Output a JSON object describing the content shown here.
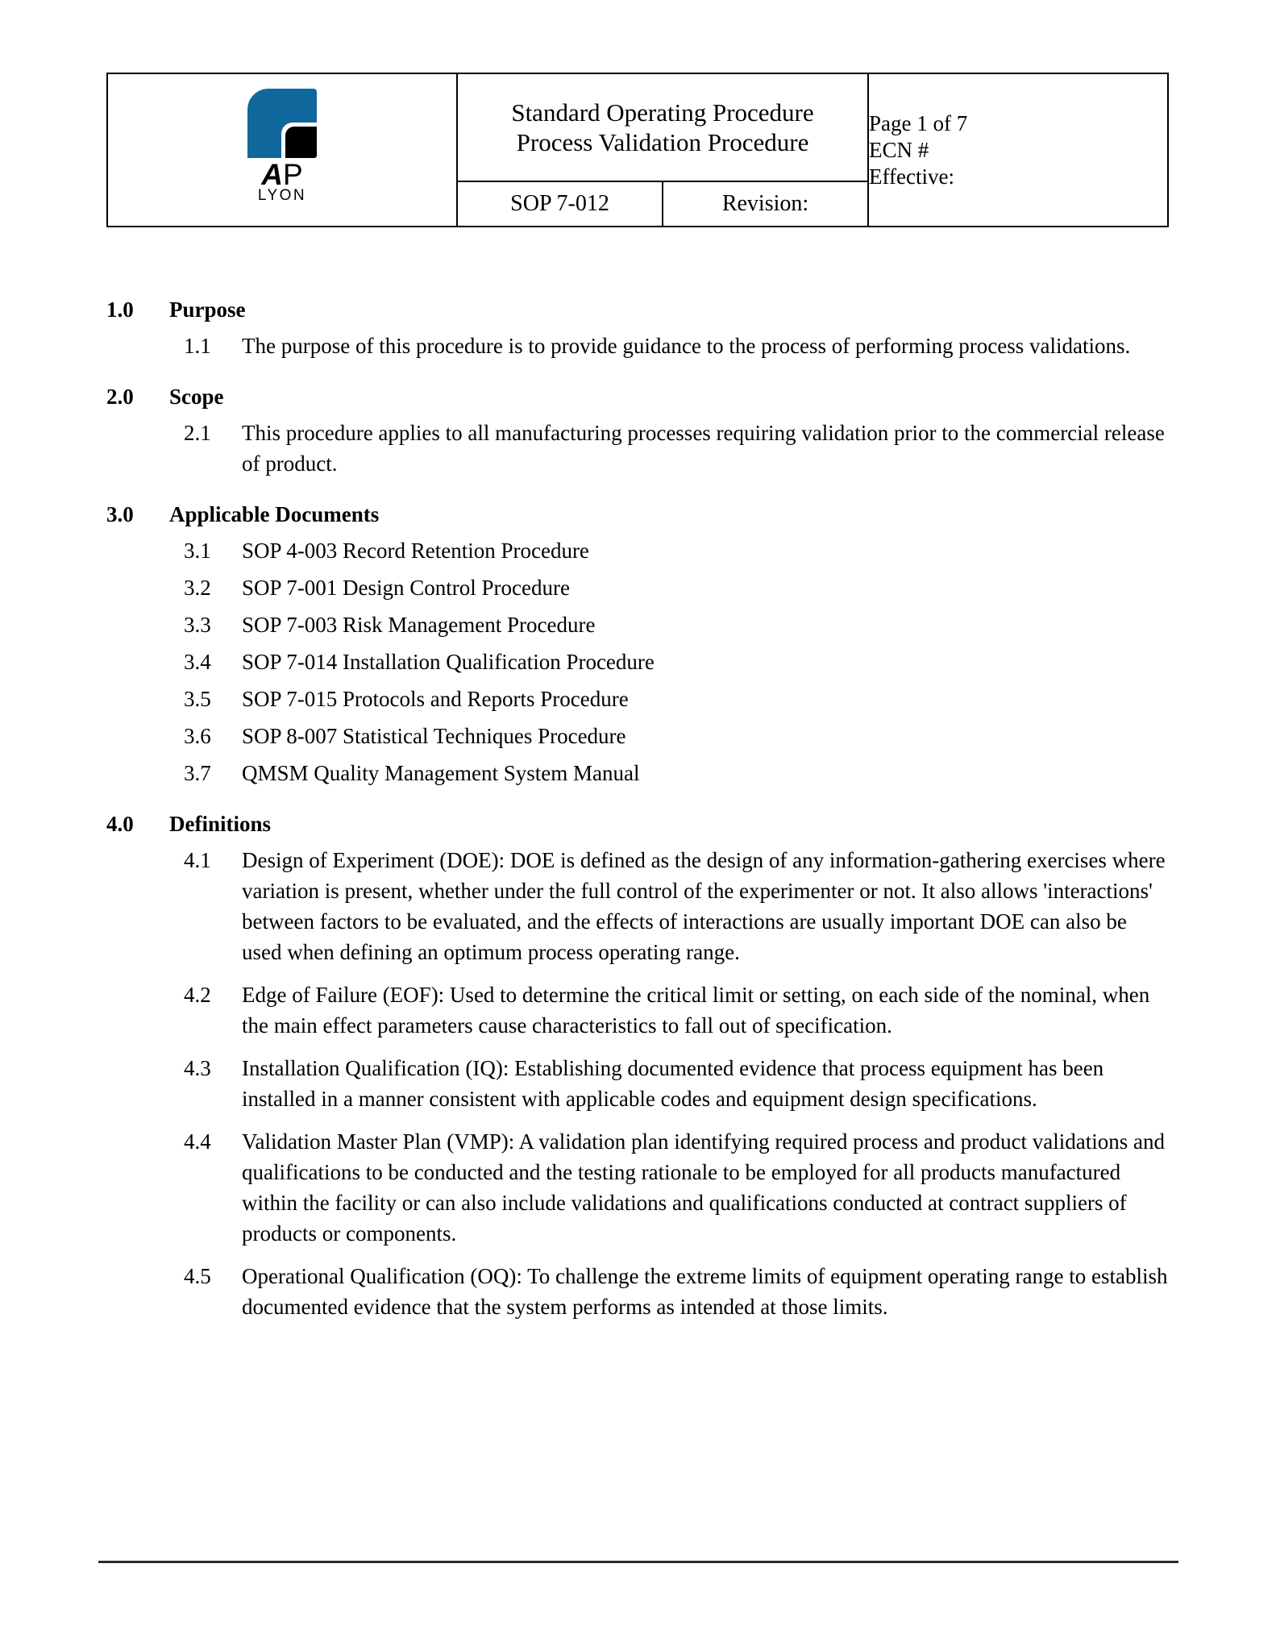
{
  "header": {
    "logo": {
      "mark_name": "ap-lyon-logo-mark",
      "brand_a": "A",
      "brand_p": "P",
      "brand_sub": "LYON",
      "blue_hex": "#10679b",
      "black_hex": "#000000"
    },
    "title_line1": "Standard Operating Procedure",
    "title_line2": "Process Validation Procedure",
    "page_info": "Page  1 of 7",
    "ecn": "ECN #",
    "effective": "Effective:",
    "sop_number": "SOP 7-012",
    "revision": "Revision:"
  },
  "sections": [
    {
      "num": "1.0",
      "title": "Purpose",
      "items": [
        {
          "num": "1.1",
          "text": "The purpose of this procedure is to provide guidance to the process of performing process validations."
        }
      ]
    },
    {
      "num": "2.0",
      "title": "Scope",
      "items": [
        {
          "num": "2.1",
          "text": "This procedure applies to all manufacturing processes requiring validation prior to the commercial release of product."
        }
      ]
    },
    {
      "num": "3.0",
      "title": "Applicable Documents",
      "items": [
        {
          "num": "3.1",
          "text": "SOP 4-003 Record Retention Procedure"
        },
        {
          "num": "3.2",
          "text": "SOP 7-001 Design Control Procedure"
        },
        {
          "num": "3.3",
          "text": "SOP 7-003 Risk Management Procedure"
        },
        {
          "num": "3.4",
          "text": "SOP 7-014 Installation Qualification Procedure"
        },
        {
          "num": "3.5",
          "text": "SOP 7-015 Protocols and Reports Procedure"
        },
        {
          "num": "3.6",
          "text": "SOP 8-007 Statistical Techniques Procedure"
        },
        {
          "num": "3.7",
          "text": "QMSM Quality Management System Manual"
        }
      ]
    },
    {
      "num": "4.0",
      "title": "Definitions",
      "items": [
        {
          "num": "4.1",
          "text": "Design of Experiment (DOE):  DOE is defined as the design of any information-gathering exercises where variation is present, whether under the full control of the experimenter or not. It also allows 'interactions' between factors to be evaluated, and the effects of interactions are usually important DOE can also be used when defining an optimum process operating range."
        },
        {
          "num": "4.2",
          "text": "Edge of Failure (EOF):  Used to determine the critical limit or setting, on each side of the nominal, when the main effect parameters cause characteristics to fall out of specification."
        },
        {
          "num": "4.3",
          "text": "Installation Qualification (IQ):  Establishing documented evidence that process equipment has been installed in a manner consistent with applicable codes and equipment design specifications."
        },
        {
          "num": "4.4",
          "text": "Validation Master Plan (VMP):  A validation plan identifying required process and product validations and qualifications to be conducted and the testing rationale to be employed for all products manufactured within the facility or can also include validations and qualifications conducted at contract suppliers of products or components."
        },
        {
          "num": "4.5",
          "text": "Operational Qualification (OQ):  To challenge the extreme limits of equipment operating range to establish documented evidence that the system performs as intended at those limits."
        }
      ]
    }
  ]
}
